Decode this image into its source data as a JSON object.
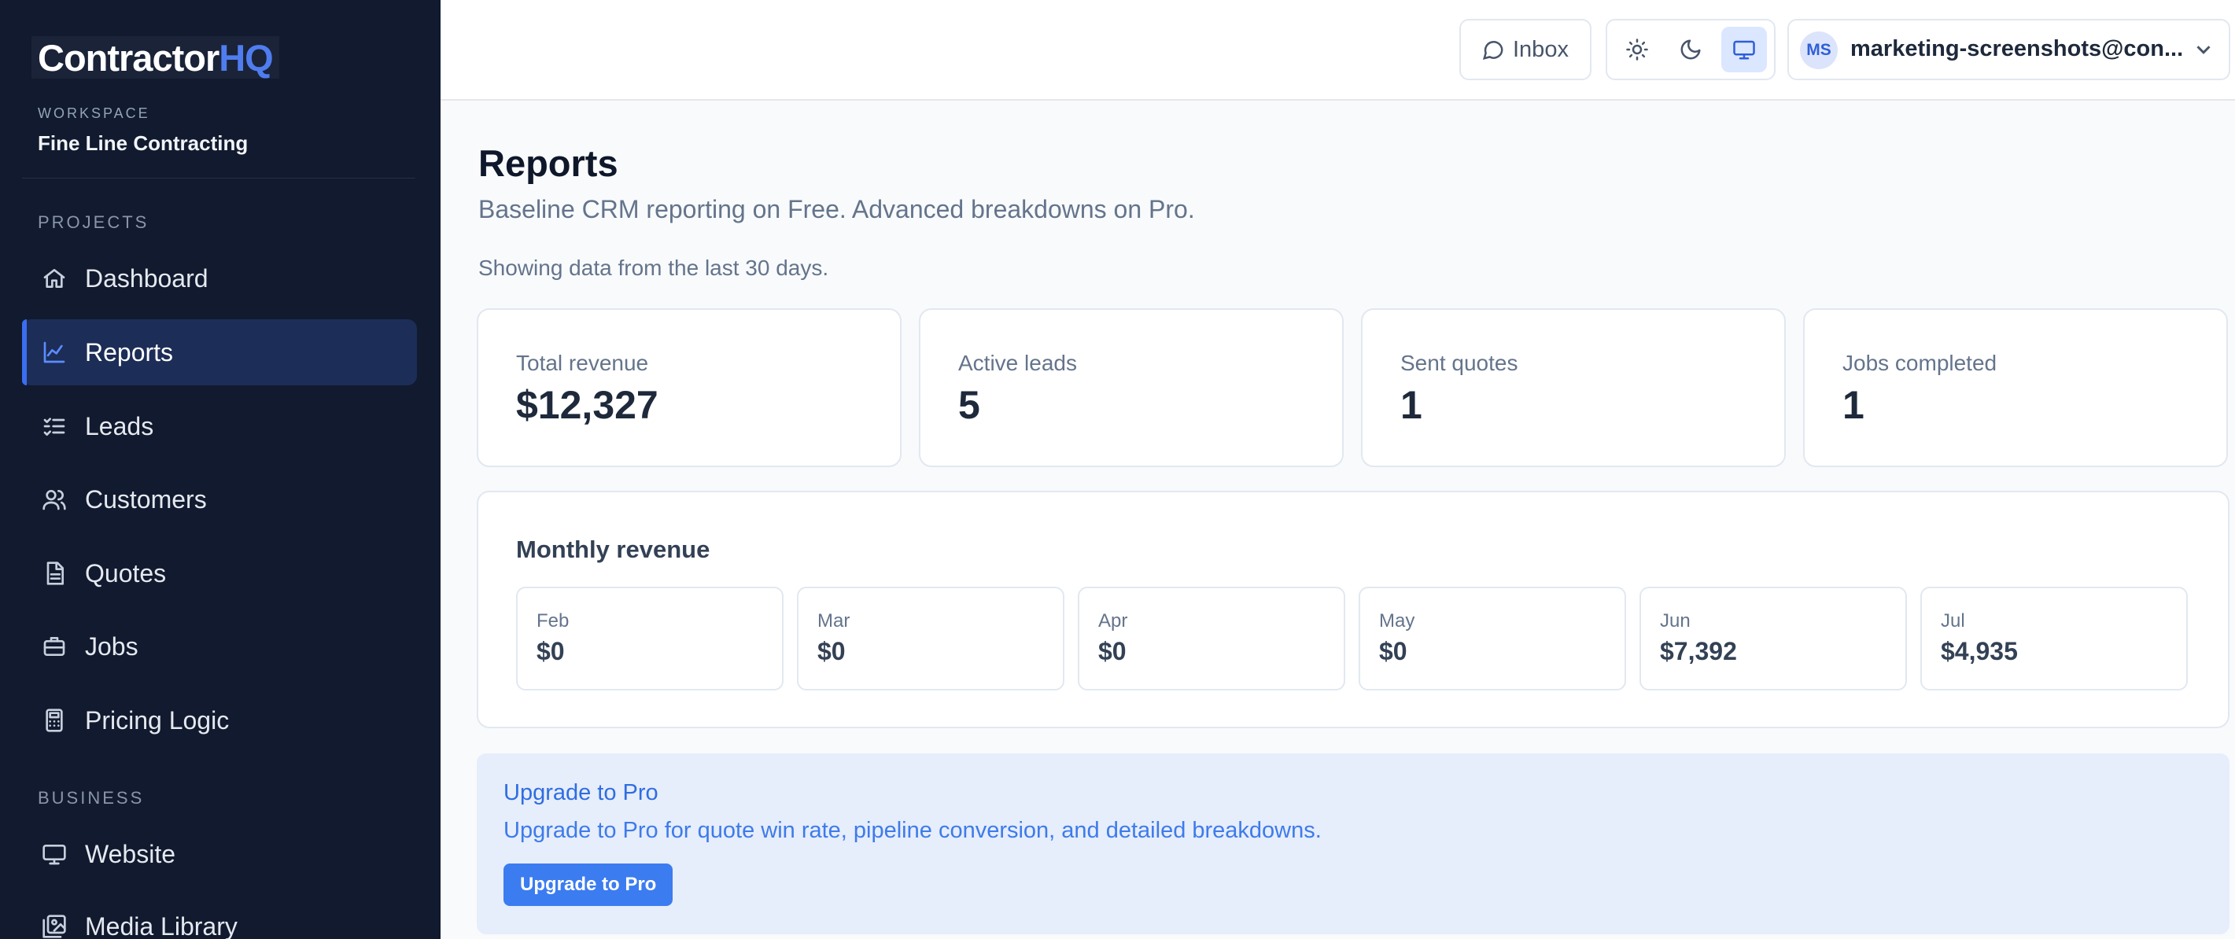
{
  "brand": {
    "name_primary": "Contractor",
    "name_accent": "HQ"
  },
  "workspace": {
    "label": "WORKSPACE",
    "name": "Fine Line Contracting"
  },
  "sidebar": {
    "projects_label": "PROJECTS",
    "business_label": "BUSINESS",
    "items": [
      {
        "label": "Dashboard",
        "icon": "home-icon"
      },
      {
        "label": "Reports",
        "icon": "chart-line-icon",
        "active": true
      },
      {
        "label": "Leads",
        "icon": "list-check-icon"
      },
      {
        "label": "Customers",
        "icon": "users-icon"
      },
      {
        "label": "Quotes",
        "icon": "file-icon"
      },
      {
        "label": "Jobs",
        "icon": "briefcase-icon"
      },
      {
        "label": "Pricing Logic",
        "icon": "calculator-icon"
      }
    ],
    "business_items": [
      {
        "label": "Website",
        "icon": "monitor-icon"
      },
      {
        "label": "Media Library",
        "icon": "image-icon"
      }
    ]
  },
  "topbar": {
    "inbox_label": "Inbox",
    "theme_options": [
      "light",
      "dark",
      "system"
    ],
    "theme_selected": "system",
    "account": {
      "initials": "MS",
      "email": "marketing-screenshots@con..."
    }
  },
  "page": {
    "title": "Reports",
    "subtitle": "Baseline CRM reporting on Free. Advanced breakdowns on Pro.",
    "range_note": "Showing data from the last 30 days."
  },
  "stats": [
    {
      "label": "Total revenue",
      "value": "$12,327"
    },
    {
      "label": "Active leads",
      "value": "5"
    },
    {
      "label": "Sent quotes",
      "value": "1"
    },
    {
      "label": "Jobs completed",
      "value": "1"
    }
  ],
  "monthly": {
    "title": "Monthly revenue",
    "months": [
      {
        "label": "Feb",
        "value": "$0"
      },
      {
        "label": "Mar",
        "value": "$0"
      },
      {
        "label": "Apr",
        "value": "$0"
      },
      {
        "label": "May",
        "value": "$0"
      },
      {
        "label": "Jun",
        "value": "$7,392"
      },
      {
        "label": "Jul",
        "value": "$4,935"
      }
    ]
  },
  "upgrade": {
    "heading": "Upgrade to Pro",
    "text": "Upgrade to Pro for quote win rate, pipeline conversion, and detailed breakdowns.",
    "button_label": "Upgrade to Pro"
  },
  "colors": {
    "sidebar_bg": "#111a2e",
    "accent": "#3b6ef0",
    "upgrade_bg": "#e6edfb"
  }
}
